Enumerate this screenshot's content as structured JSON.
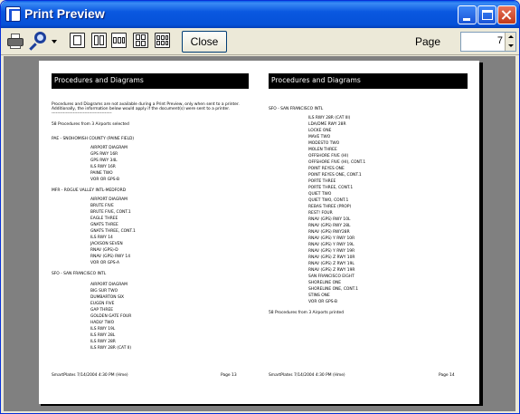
{
  "window": {
    "title": "Print Preview",
    "icons": {
      "app": "app-icon",
      "minimize": "minimize-icon",
      "maximize": "maximize-icon",
      "close": "close-icon"
    }
  },
  "toolbar": {
    "print_icon": "printer-icon",
    "zoom_icon": "magnifier-icon",
    "close_label": "Close",
    "page_label": "Page",
    "page_value": "7"
  },
  "left_page": {
    "banner": "Procedures and Diagrams",
    "notice_1": "Procedures and Diagrams are not available during a Print Preview, only when sent to a printer.",
    "notice_2": "Additionally, the information below would apply if the document(s) were sent to a printer.",
    "notice_rule": "------------------------------------------",
    "selected": "58 Procedures from 3 Airports selected",
    "airports": [
      {
        "name": "PAE - SNOHOMISH COUNTY (PAINE FIELD)",
        "procedures": [
          "AIRPORT DIAGRAM",
          "GPS RWY 16R",
          "GPS RWY 34L",
          "ILS RWY 16R",
          "PAINE TWO",
          "VOR OR GPS-B"
        ]
      },
      {
        "name": "MFR - ROGUE VALLEY INTL-MEDFORD",
        "procedures": [
          "AIRPORT DIAGRAM",
          "BRUTE FIVE",
          "BRUTE FIVE, CONT.1",
          "EAGLE THREE",
          "GNATS THREE",
          "GNATS THREE, CONT.1",
          "ILS RWY 14",
          "JACKSON SEVEN",
          "RNAV (GPS)-D",
          "RNAV (GPS) RWY 14",
          "VOR OR GPS-A"
        ]
      },
      {
        "name": "SFO - SAN FRANCISCO INTL",
        "procedures": [
          "AIRPORT DIAGRAM",
          "BIG SUR TWO",
          "DUMBARTON SIX",
          "EUGEN FIVE",
          "GAP THREE",
          "GOLDEN GATE FOUR",
          "HADLY TWO",
          "ILS RWY 19L",
          "ILS RWY 28L",
          "ILS RWY 28R",
          "ILS RWY 28R (CAT II)"
        ]
      }
    ],
    "footer_left": "SmartPlates 7/14/2004 4:30 PM (Hme)",
    "footer_right": "Page 13"
  },
  "right_page": {
    "banner": "Procedures and Diagrams",
    "airport": "SFO - SAN FRANCISCO INTL",
    "procedures": [
      "ILS RWY 28R (CAT III)",
      "LDA/DME RWY 28R",
      "LOCKE ONE",
      "MAVE TWO",
      "MODESTO TWO",
      "MOLEN THREE",
      "OFFSHORE FIVE (HI)",
      "OFFSHORE FIVE (HI), CONT.1",
      "POINT REYES ONE",
      "POINT REYES ONE, CONT.1",
      "PORTE THREE",
      "PORTE THREE, CONT.1",
      "QUIET TWO",
      "QUIET TWO, CONT.1",
      "REBAS THREE (PROP)",
      "REST! FOUR",
      "RNAV (GPS) RWY 10L",
      "RNAV (GPS) RWY 28L",
      "RNAV (GPS) RWY28R",
      "RNAV (GPS) Y RWY 10R",
      "RNAV (GPS) Y RWY 19L",
      "RNAV (GPS) Y RWY 19R",
      "RNAV (GPS) Z RWY 10R",
      "RNAV (GPS) Z RWY 19L",
      "RNAV (GPS) Z RWY 19R",
      "SAN FRANCISCO EIGHT",
      "SHORELINE ONE",
      "SHORELINE ONE, CONT.1",
      "STINS ONE",
      "VOR OR GPS-B"
    ],
    "printed": "58 Procedures from 3 Airports printed",
    "footer_left": "SmartPlates 7/14/2004 4:30 PM (Hme)",
    "footer_right": "Page 14"
  }
}
